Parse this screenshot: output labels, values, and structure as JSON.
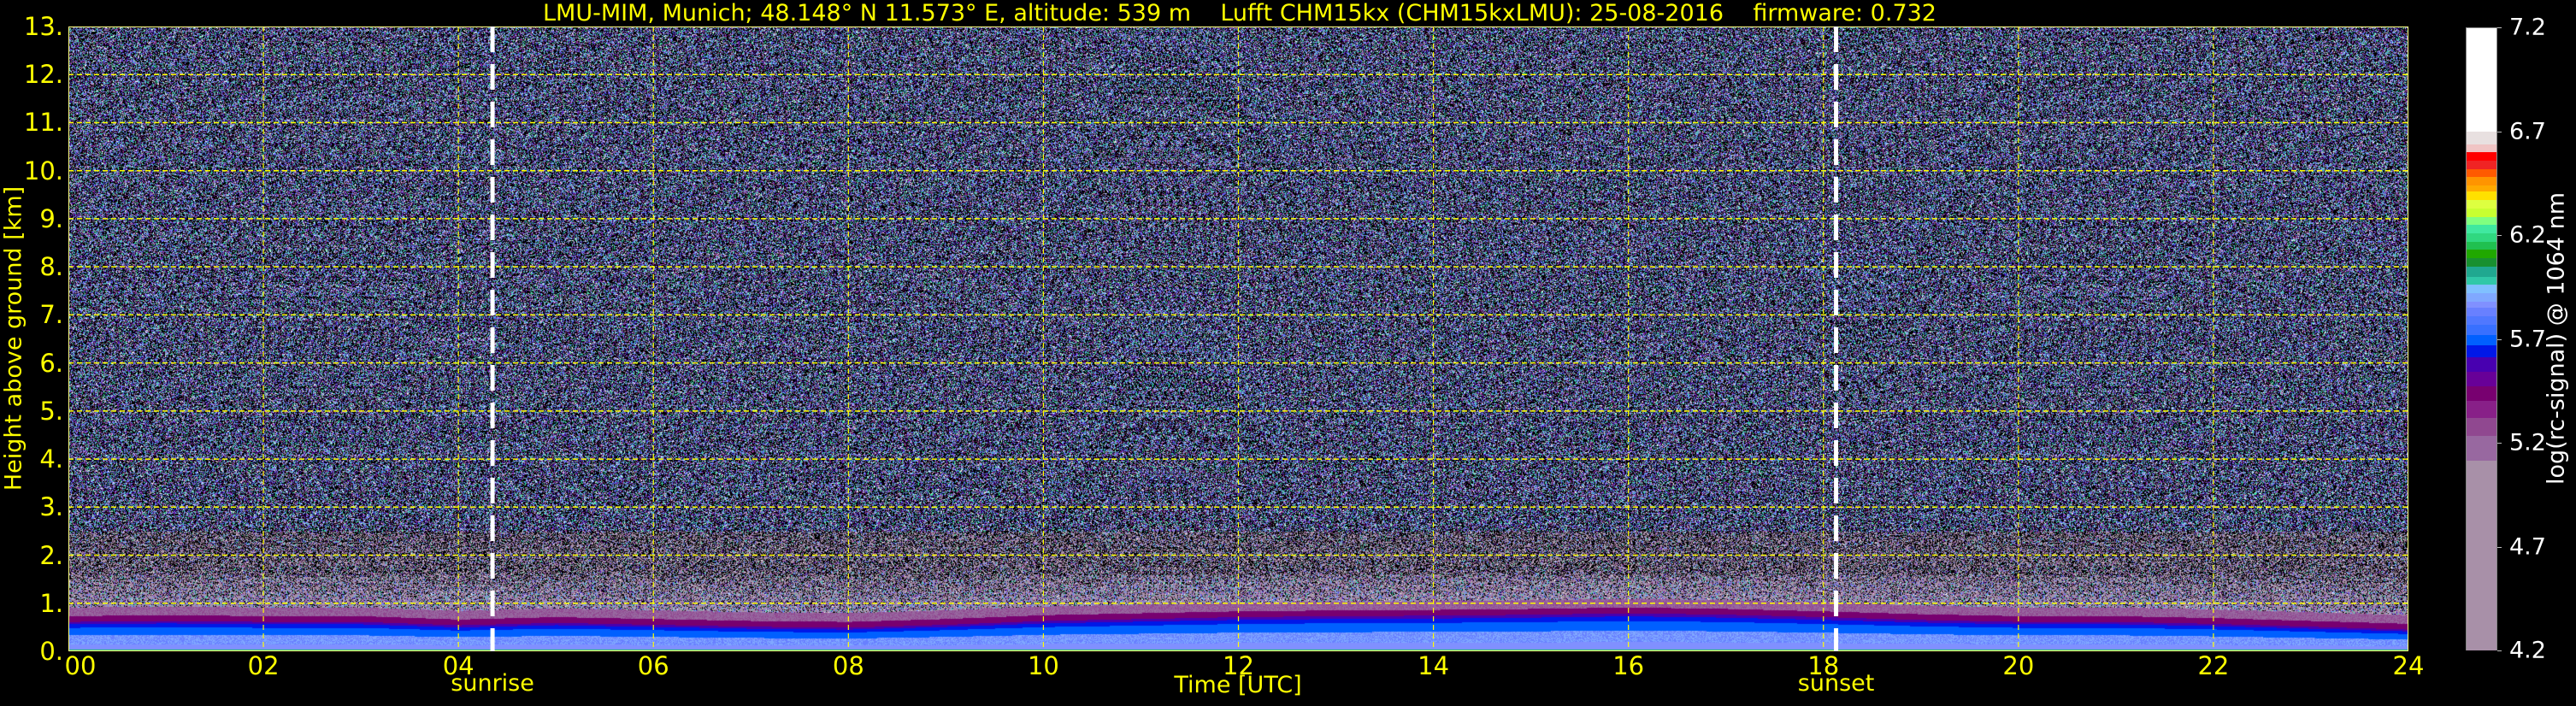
{
  "chart_data": {
    "type": "heatmap",
    "title": "LMU-MIM, Munich; 48.148° N 11.573° E, altitude: 539 m    Lufft CHM15kx (CHM15kxLMU): 25-08-2016    firmware: 0.732",
    "xlabel": "Time [UTC]",
    "ylabel": "Height above ground [km]",
    "xlim": [
      0,
      24
    ],
    "ylim": [
      0,
      13
    ],
    "x_ticks": [
      "00",
      "02",
      "04",
      "06",
      "08",
      "10",
      "12",
      "14",
      "16",
      "18",
      "20",
      "22",
      "24"
    ],
    "y_ticks": [
      "0.",
      "1.",
      "2.",
      "3.",
      "4.",
      "5.",
      "6.",
      "7.",
      "8.",
      "9.",
      "10.",
      "11.",
      "12.",
      "13."
    ],
    "grid": true,
    "annotations": [
      {
        "label": "sunrise",
        "time_utc": 4.35
      },
      {
        "label": "sunset",
        "time_utc": 18.13
      }
    ],
    "colorbar": {
      "label": "log(rc-signal) @ 1064 nm",
      "range": [
        4.2,
        7.2
      ],
      "ticks": [
        "4.2",
        "4.7",
        "5.2",
        "5.7",
        "6.2",
        "6.7",
        "7.2"
      ],
      "levels_top_to_bottom": [
        {
          "to": 6.7,
          "color": "#ffffff"
        },
        {
          "to": 6.64,
          "color": "#e8e0e0"
        },
        {
          "to": 6.6,
          "color": "#f0c4c4"
        },
        {
          "to": 6.56,
          "color": "#ff0000"
        },
        {
          "to": 6.52,
          "color": "#f02424"
        },
        {
          "to": 6.48,
          "color": "#ff5a00"
        },
        {
          "to": 6.44,
          "color": "#ff9400"
        },
        {
          "to": 6.41,
          "color": "#ffaa00"
        },
        {
          "to": 6.37,
          "color": "#ffe000"
        },
        {
          "to": 6.33,
          "color": "#ddff40"
        },
        {
          "to": 6.29,
          "color": "#c8ff30"
        },
        {
          "to": 6.25,
          "color": "#80ff80"
        },
        {
          "to": 6.21,
          "color": "#40e8a0"
        },
        {
          "to": 6.17,
          "color": "#30d880"
        },
        {
          "to": 6.13,
          "color": "#20c050"
        },
        {
          "to": 6.09,
          "color": "#20a800"
        },
        {
          "to": 6.05,
          "color": "#189030"
        },
        {
          "to": 6.0,
          "color": "#20a890"
        },
        {
          "to": 5.96,
          "color": "#30c8a8"
        },
        {
          "to": 5.92,
          "color": "#80c0ff"
        },
        {
          "to": 5.88,
          "color": "#80a8ff"
        },
        {
          "to": 5.85,
          "color": "#8090ff"
        },
        {
          "to": 5.81,
          "color": "#6880ff"
        },
        {
          "to": 5.77,
          "color": "#5078ff"
        },
        {
          "to": 5.72,
          "color": "#3870ff"
        },
        {
          "to": 5.67,
          "color": "#0060ff"
        },
        {
          "to": 5.61,
          "color": "#0018e8"
        },
        {
          "to": 5.54,
          "color": "#4800b0"
        },
        {
          "to": 5.47,
          "color": "#680098"
        },
        {
          "to": 5.4,
          "color": "#780070"
        },
        {
          "to": 5.32,
          "color": "#882088"
        },
        {
          "to": 5.23,
          "color": "#904890"
        },
        {
          "to": 5.11,
          "color": "#9868a0"
        },
        {
          "to": 4.2,
          "color": "#a890a8"
        }
      ]
    },
    "boundary_layer_top_km": {
      "hours": [
        0,
        1,
        2,
        3,
        4,
        5,
        6,
        7,
        8,
        9,
        10,
        11,
        12,
        13,
        14,
        15,
        16,
        17,
        18,
        19,
        20,
        21,
        22,
        23,
        24
      ],
      "values": [
        0.62,
        0.64,
        0.62,
        0.62,
        0.55,
        0.6,
        0.56,
        0.52,
        0.5,
        0.56,
        0.64,
        0.68,
        0.72,
        0.74,
        0.75,
        0.77,
        0.8,
        0.77,
        0.72,
        0.66,
        0.62,
        0.62,
        0.58,
        0.52,
        0.46
      ]
    }
  },
  "colors": {
    "text": "#ffff00",
    "grid": "#ffff00",
    "marker": "#ffffff",
    "background": "#000000"
  }
}
